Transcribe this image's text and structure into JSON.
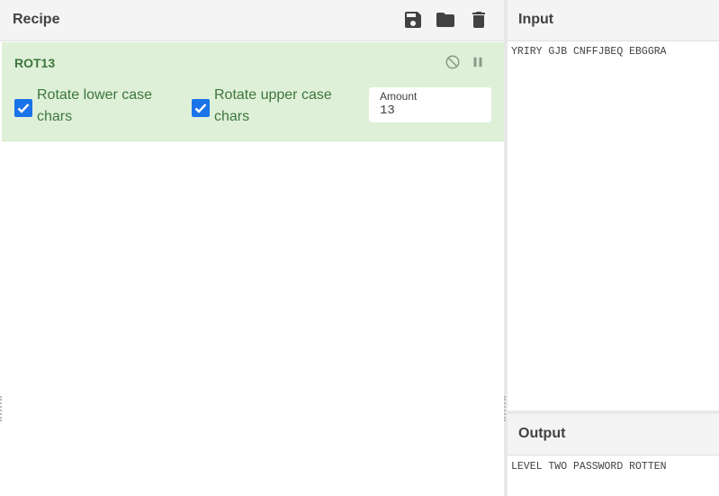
{
  "recipe": {
    "title": "Recipe",
    "icons": {
      "save": "save-icon",
      "load": "folder-icon",
      "clear": "trash-icon"
    },
    "operation": {
      "name": "ROT13",
      "icons": {
        "disable": "disable-icon",
        "breakpoint": "pause-icon"
      },
      "options": {
        "rotate_lower": {
          "label_line1": "Rotate lower case",
          "label_line2": "chars",
          "checked": true
        },
        "rotate_upper": {
          "label_line1": "Rotate upper case",
          "label_line2": "chars",
          "checked": true
        },
        "amount": {
          "label": "Amount",
          "value": "13"
        }
      }
    }
  },
  "input": {
    "title": "Input",
    "text": "YRIRY GJB CNFFJBEQ EBGGRA"
  },
  "output": {
    "title": "Output",
    "text": "LEVEL TWO PASSWORD ROTTEN"
  },
  "colors": {
    "op_background": "#dff0d8",
    "op_text": "#3c763d",
    "checkbox": "#1a73e8",
    "header_bg": "#f4f4f4"
  }
}
